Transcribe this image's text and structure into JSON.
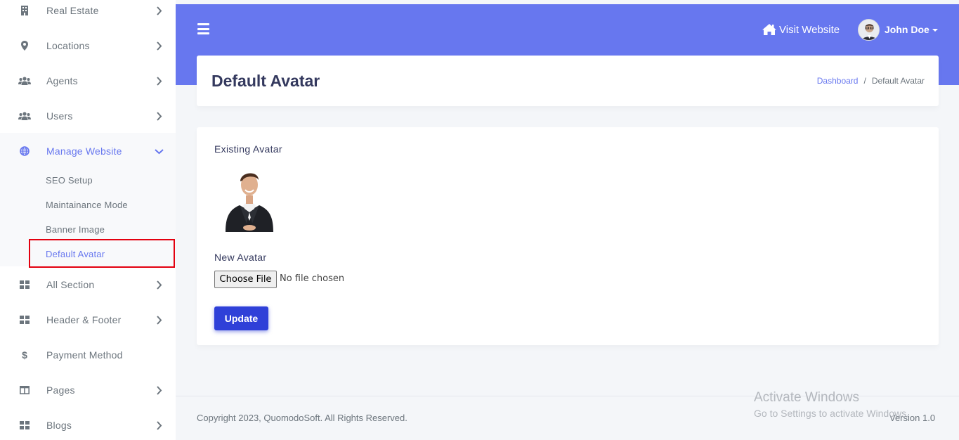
{
  "sidebar": {
    "items": [
      {
        "label": "Real Estate",
        "icon": "building-icon"
      },
      {
        "label": "Locations",
        "icon": "map-marker-icon"
      },
      {
        "label": "Agents",
        "icon": "users-icon"
      },
      {
        "label": "Users",
        "icon": "users-icon"
      },
      {
        "label": "Manage Website",
        "icon": "globe-icon"
      },
      {
        "label": "All Section",
        "icon": "grid-icon"
      },
      {
        "label": "Header & Footer",
        "icon": "grid-icon"
      },
      {
        "label": "Payment Method",
        "icon": "dollar-icon"
      },
      {
        "label": "Pages",
        "icon": "columns-icon"
      },
      {
        "label": "Blogs",
        "icon": "grid-icon"
      }
    ],
    "submenu": [
      {
        "label": "SEO Setup"
      },
      {
        "label": "Maintainance Mode"
      },
      {
        "label": "Banner Image"
      },
      {
        "label": "Default Avatar"
      }
    ]
  },
  "header": {
    "visit_label": "Visit Website",
    "user_name": "John Doe"
  },
  "page": {
    "title": "Default Avatar",
    "breadcrumb": [
      "Dashboard",
      "/",
      "Default Avatar"
    ]
  },
  "form": {
    "existing_label": "Existing Avatar",
    "new_label": "New Avatar",
    "choose_file": "Choose File",
    "no_file": "No file chosen",
    "update": "Update"
  },
  "footer": {
    "copyright": "Copyright 2023, QuomodoSoft. All Rights Reserved.",
    "version": "Version 1.0"
  },
  "watermark": {
    "title": "Activate Windows",
    "subtitle": "Go to Settings to activate Windows."
  },
  "colors": {
    "accent": "#6777ef",
    "button": "#2f40d8",
    "highlight": "#e3000f"
  }
}
